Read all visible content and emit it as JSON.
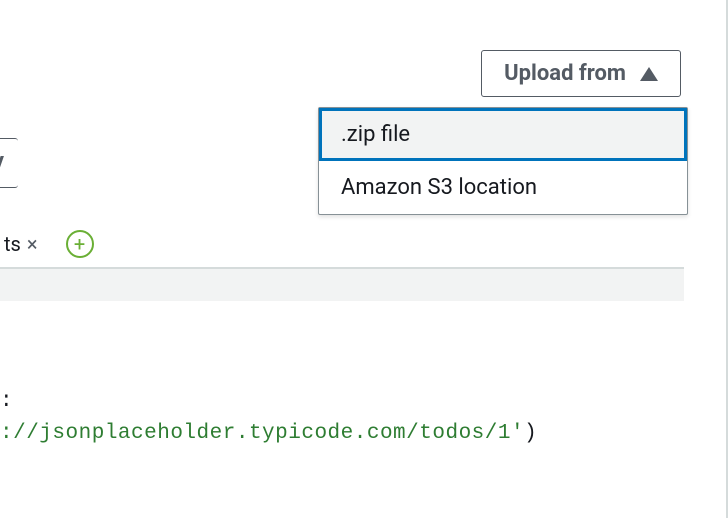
{
  "toolbar": {
    "upload_label": "Upload from",
    "partial_button_label": "y"
  },
  "dropdown": {
    "items": [
      {
        "label": ".zip file",
        "highlighted": true
      },
      {
        "label": "Amazon S3 location",
        "highlighted": false
      }
    ]
  },
  "tabs": {
    "partial_tab_label": "ts",
    "close_glyph": "×"
  },
  "code": {
    "line1_text": ":",
    "line2_prefix": "://jsonplaceholder.typicode.com/todos/1'",
    "line2_suffix": ")"
  }
}
